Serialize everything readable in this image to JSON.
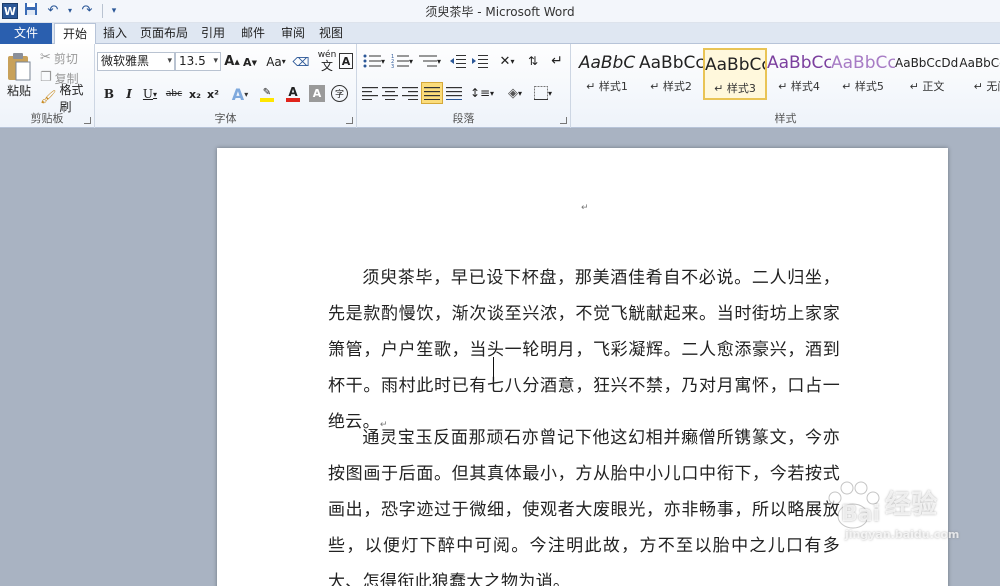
{
  "app": {
    "title": "须臾茶毕 - Microsoft Word",
    "logo": "W"
  },
  "tabs": [
    "文件",
    "开始",
    "插入",
    "页面布局",
    "引用",
    "邮件",
    "审阅",
    "视图"
  ],
  "clipboard": {
    "paste": "粘贴",
    "cut": "剪切",
    "copy": "复制",
    "format_painter": "格式刷",
    "group_label": "剪贴板"
  },
  "font": {
    "name": "微软雅黑",
    "size": "13.5",
    "group_label": "字体",
    "grow": "A",
    "shrink": "A",
    "case": "Aa",
    "wen": "wén",
    "bold": "B",
    "italic": "I",
    "underline": "U",
    "strike": "abc",
    "subscript": "x₂",
    "superscript": "x²",
    "effects": "A",
    "highlight": "ab",
    "color": "A",
    "shade": "A",
    "enclose": "字",
    "highlight_color": "#ffe600",
    "font_color": "#e0241b"
  },
  "paragraph": {
    "group_label": "段落"
  },
  "styles": {
    "group_label": "样式",
    "items": [
      {
        "sample": "AaBbC",
        "name": "↵ 样式1",
        "color": "#222222",
        "italic": true
      },
      {
        "sample": "AaBbCc",
        "name": "↵ 样式2",
        "color": "#222222",
        "italic": false
      },
      {
        "sample": "AaBbCc",
        "name": "↵ 样式3",
        "color": "#222222",
        "italic": false
      },
      {
        "sample": "AaBbCc",
        "name": "↵ 样式4",
        "color": "#7b3f9e",
        "italic": false
      },
      {
        "sample": "AaBbCc",
        "name": "↵ 样式5",
        "color": "#a77cc5",
        "italic": false
      },
      {
        "sample": "AaBbCcDdI",
        "name": "↵ 正文",
        "color": "#222222",
        "italic": false
      },
      {
        "sample": "AaBbCcDd",
        "name": "↵ 无间",
        "color": "#222222",
        "italic": false
      }
    ]
  },
  "document": {
    "paragraphs": [
      "须臾茶毕，早已设下杯盘，那美酒佳肴自不必说。二人归坐，先是款酌慢饮，渐次谈至兴浓，不觉飞觥献起来。当时街坊上家家箫管，户户笙歌，当头一轮明月，飞彩凝辉。二人愈添豪兴，酒到杯干。雨村此时已有七八分酒意，狂兴不禁，乃对月寓怀，口占一绝云。",
      "通灵宝玉反面那顽石亦曾记下他这幻相并癞僧所镌篆文，今亦按图画于后面。但其真体最小，方从胎中小儿口中衔下，今若按式画出，恐字迹过于微细，使观者大废眼光，亦非畅事，所以略展放些，以便灯下醉中可阅。今注明此故，方不至以胎中之儿口有多大、怎得衔此狼蠢大之物为诮。"
    ],
    "pilcrow": "↵"
  },
  "watermark": {
    "text1": "Bai",
    "text2": "经验",
    "text3": "jingyan.baidu.com"
  }
}
